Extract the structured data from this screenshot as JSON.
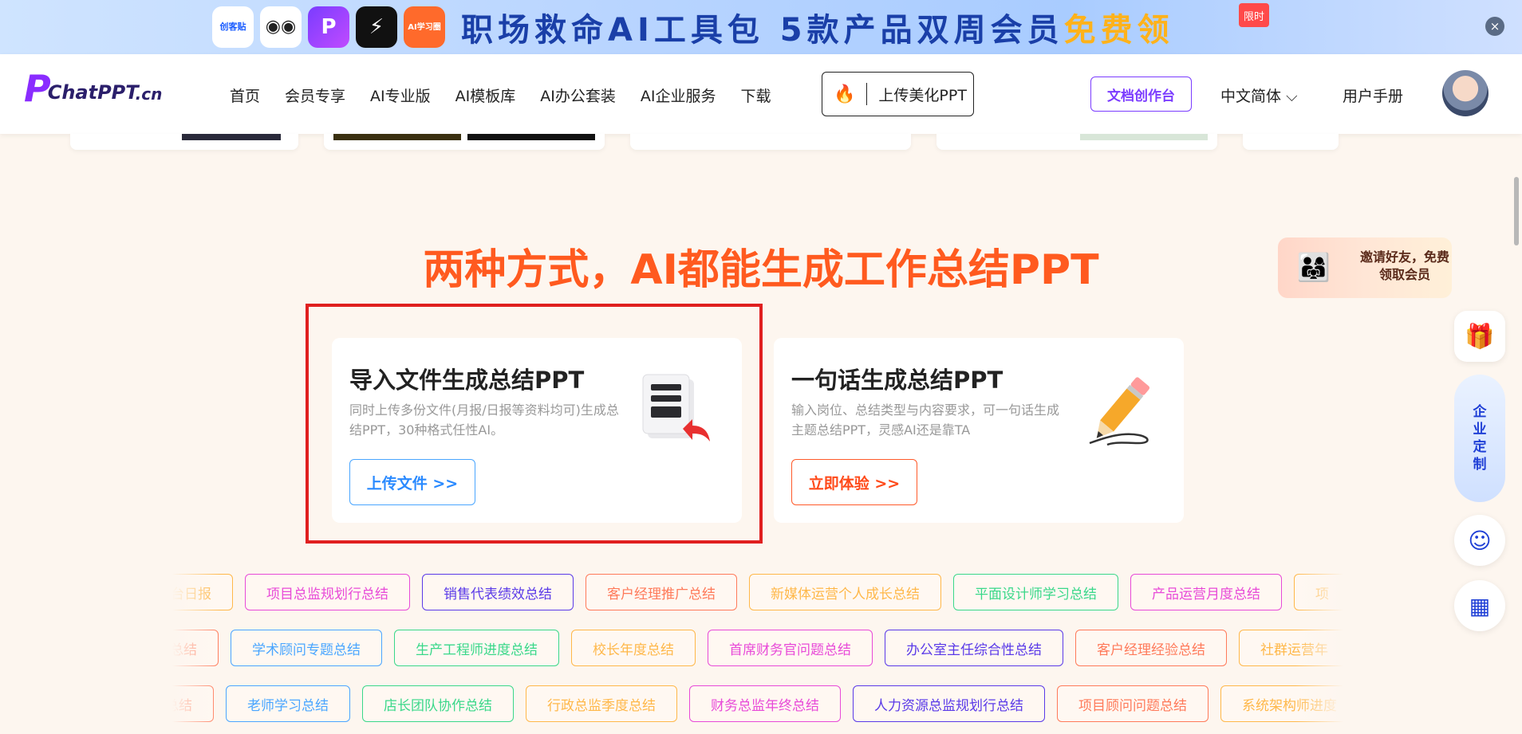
{
  "banner": {
    "apps": [
      {
        "name": "chuangkit-icon",
        "label": "创客贴"
      },
      {
        "name": "robot-icon",
        "label": "◉◉"
      },
      {
        "name": "p-icon",
        "label": "P"
      },
      {
        "name": "bolt-icon",
        "label": "⚡"
      },
      {
        "name": "ai-study-icon",
        "label": "AI学习圈"
      }
    ],
    "title_main": "职场救命AI工具包  5款产品双周会员",
    "title_free": "免费领",
    "badge": "限时",
    "close": "×"
  },
  "nav": {
    "logo_p": "P",
    "logo_text": "ChatPPT",
    "logo_cn": ".cn",
    "links": [
      "首页",
      "会员专享",
      "AI专业版",
      "AI模板库",
      "AI办公套装",
      "AI企业服务",
      "下载"
    ],
    "upload_label": "上传美化PPT",
    "doc_button": "文档创作台",
    "language": "中文简体",
    "manual": "用户手册"
  },
  "main": {
    "headline": "两种方式，AI都能生成工作总结PPT",
    "cards": [
      {
        "title": "导入文件生成总结PPT",
        "desc": "同时上传多份文件(月报/日报等资料均可)生成总结PPT，30种格式任性AI。",
        "button": "上传文件 >>"
      },
      {
        "title": "一句话生成总结PPT",
        "desc": "输入岗位、总结类型与内容要求，可一句话生成主题总结PPT，灵感AI还是靠TA",
        "button": "立即体验 >>"
      }
    ]
  },
  "tags": {
    "row1": [
      "前台日报",
      "项目总监规划行总结",
      "销售代表绩效总结",
      "客户经理推广总结",
      "新媒体运营个人成长总结",
      "平面设计师学习总结",
      "产品运营月度总结",
      "项"
    ],
    "row2": [
      "总结",
      "学术顾问专题总结",
      "生产工程师进度总结",
      "校长年度总结",
      "首席财务官问题总结",
      "办公室主任综合性总结",
      "客户经理经验总结",
      "社群运营年"
    ],
    "row3": [
      "总结",
      "老师学习总结",
      "店长团队协作总结",
      "行政总监季度总结",
      "财务总监年终总结",
      "人力资源总监规划行总结",
      "项目顾问问题总结",
      "系统架构师进度"
    ],
    "colors": [
      "#ffb84a",
      "#e84ad8",
      "#5a3ae8",
      "#ff7a5a",
      "#ffb84a",
      "#3ad88a",
      "#e84ad8",
      "#ffb84a"
    ],
    "colors2": [
      "#ff7a5a",
      "#4aa6ff",
      "#3ad88a",
      "#ffb84a",
      "#e84ad8",
      "#5a3ae8",
      "#ff7a5a",
      "#ffb84a"
    ],
    "colors3": [
      "#ff7a5a",
      "#4aa6ff",
      "#3ad88a",
      "#ffb84a",
      "#e84ad8",
      "#5a3ae8",
      "#ff7a5a",
      "#ffb84a"
    ]
  },
  "side": {
    "invite": "邀请好友，免费领取会员",
    "enterprise": [
      "企",
      "业",
      "定",
      "制"
    ]
  }
}
